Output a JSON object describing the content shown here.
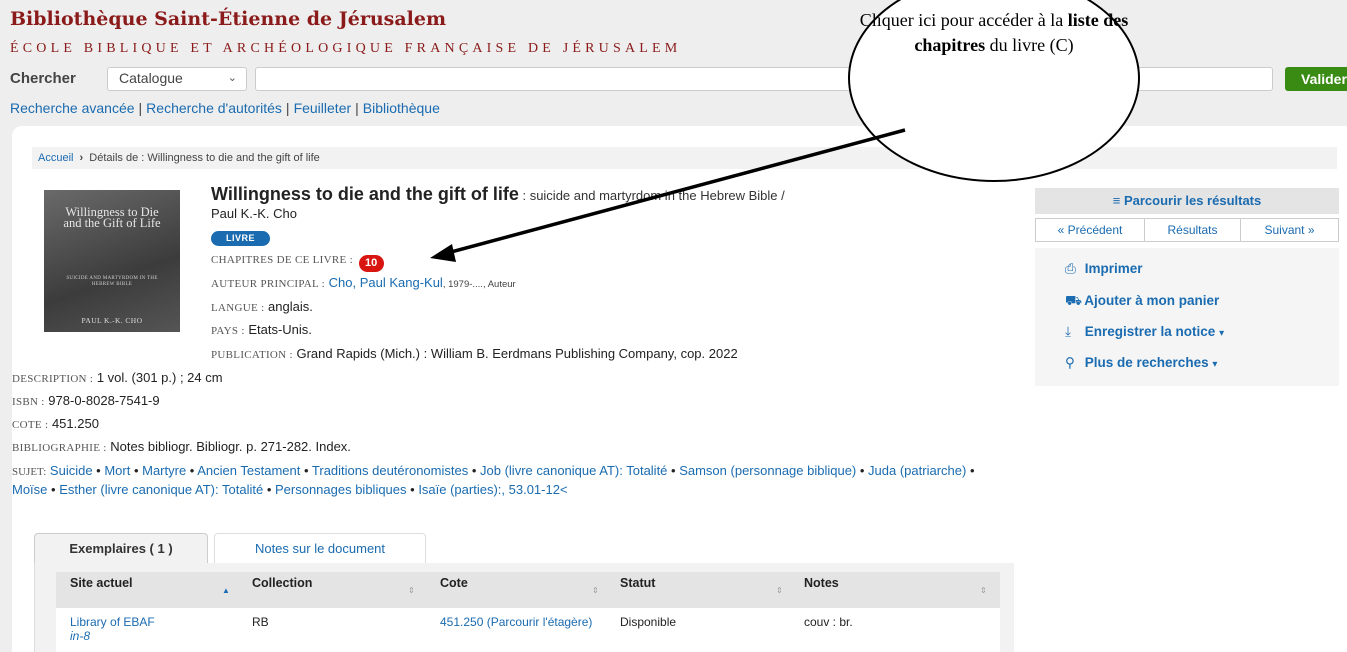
{
  "header": {
    "title": "Bibliothèque Saint-Étienne de Jérusalem",
    "subtitle": "ÉCOLE BIBLIQUE ET ARCHÉOLOGIQUE FRANÇAISE DE JÉRUSALEM"
  },
  "search": {
    "label": "Chercher",
    "scope_value": "Catalogue",
    "query_value": "",
    "submit_label": "Valider"
  },
  "nav_links": [
    "Recherche avancée",
    "Recherche d'autorités",
    "Feuilleter",
    "Bibliothèque"
  ],
  "nav_sep": "|",
  "breadcrumb": {
    "home": "Accueil",
    "separator": "›",
    "current": "Détails de : Willingness to die and the gift of life"
  },
  "cover": {
    "title": "Willingness to Die and the Gift of Life",
    "subtitle": "SUICIDE AND MARTYRDOM IN THE HEBREW BIBLE",
    "author": "PAUL K.-K. CHO"
  },
  "record": {
    "title": "Willingness to die and the gift of life",
    "title_rest": ": suicide and martyrdom in the Hebrew Bible /",
    "responsibility": "Paul K.-K. Cho",
    "type_badge": "LIVRE",
    "chapters_label": "CHAPITRES DE CE LIVRE :",
    "chapters_count": "10",
    "author_label": "AUTEUR PRINCIPAL :",
    "author_name": "Cho, Paul Kang-Kul",
    "author_extra": ", 1979-...., Auteur",
    "language_label": "LANGUE :",
    "language": "anglais.",
    "country_label": "PAYS :",
    "country": "Etats-Unis.",
    "publication_label": "PUBLICATION :",
    "publication": "Grand Rapids (Mich.) : William B. Eerdmans Publishing Company, cop. 2022",
    "description_label": "DESCRIPTION :",
    "description": "1 vol. (301 p.) ; 24 cm",
    "isbn_label": "ISBN :",
    "isbn": "978-0-8028-7541-9",
    "cote_label": "COTE :",
    "cote": "451.250",
    "bibliography_label": "BIBLIOGRAPHIE :",
    "bibliography": "Notes bibliogr. Bibliogr. p. 271-282. Index.",
    "subjects_label": "SUJET:",
    "subjects_bullet": " • ",
    "subjects": [
      "Suicide",
      "Mort",
      "Martyre",
      "Ancien Testament",
      "Traditions deutéronomistes",
      "Job (livre canonique AT): Totalité",
      "Samson (personnage biblique)",
      "Juda (patriarche)",
      "Moïse",
      "Esther (livre canonique AT): Totalité",
      "Personnages bibliques",
      "Isaïe (parties):, 53.01-12<"
    ]
  },
  "tabs": [
    {
      "label": "Exemplaires ( 1 )",
      "active": true
    },
    {
      "label": "Notes sur le document",
      "active": false
    }
  ],
  "holdings": {
    "columns": [
      "Site actuel",
      "Collection",
      "Cote",
      "Statut",
      "Notes"
    ],
    "rows": [
      {
        "site": "Library of EBAF",
        "site_sub": "in-8",
        "collection": "RB",
        "cote": "451.250",
        "cote_link": "(Parcourir l'étagère)",
        "statut": "Disponible",
        "notes": "couv : br."
      }
    ]
  },
  "sidebar": {
    "browse_label": "Parcourir les résultats",
    "prev_label": "« Précédent",
    "results_label": "Résultats",
    "next_label": "Suivant »",
    "actions": [
      {
        "label": "Imprimer",
        "icon": "print-icon"
      },
      {
        "label": "Ajouter à mon panier",
        "icon": "cart-icon"
      },
      {
        "label": "Enregistrer la notice",
        "icon": "download-icon",
        "caret": "▾"
      },
      {
        "label": "Plus de recherches",
        "icon": "search-icon",
        "caret": "▾"
      }
    ]
  },
  "callout": {
    "text_1": "Cliquer ici pour accéder  à la",
    "text_bold": "liste des chapitres",
    "text_2": "du livre (C)"
  },
  "colors": {
    "brand": "#8b1a1a",
    "link": "#1a6bb0",
    "valider": "#3a8b14",
    "badge_red": "#d9150f"
  }
}
